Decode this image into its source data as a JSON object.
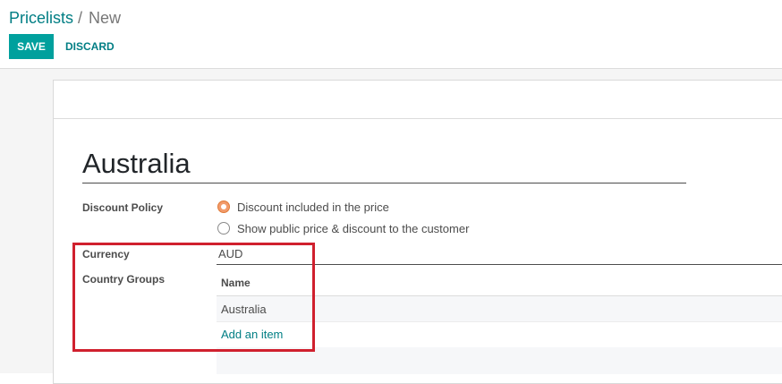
{
  "breadcrumb": {
    "parent": "Pricelists",
    "separator": "/",
    "current": "New"
  },
  "buttons": {
    "save": "SAVE",
    "discard": "DISCARD"
  },
  "form": {
    "name": "Australia",
    "discount_policy": {
      "label": "Discount Policy",
      "options": [
        {
          "label": "Discount included in the price",
          "selected": true
        },
        {
          "label": "Show public price & discount to the customer",
          "selected": false
        }
      ]
    },
    "currency": {
      "label": "Currency",
      "value": "AUD"
    },
    "country_groups": {
      "label": "Country Groups",
      "column_header": "Name",
      "rows": [
        "Australia"
      ],
      "add_item": "Add an item"
    }
  },
  "colors": {
    "primary": "#00a09d",
    "link": "#017e84",
    "radio_selected": "#f29b6b",
    "highlight": "#d0202e"
  },
  "icons": {
    "radio_selected": "radio-checked-icon",
    "radio_unselected": "radio-unchecked-icon"
  }
}
